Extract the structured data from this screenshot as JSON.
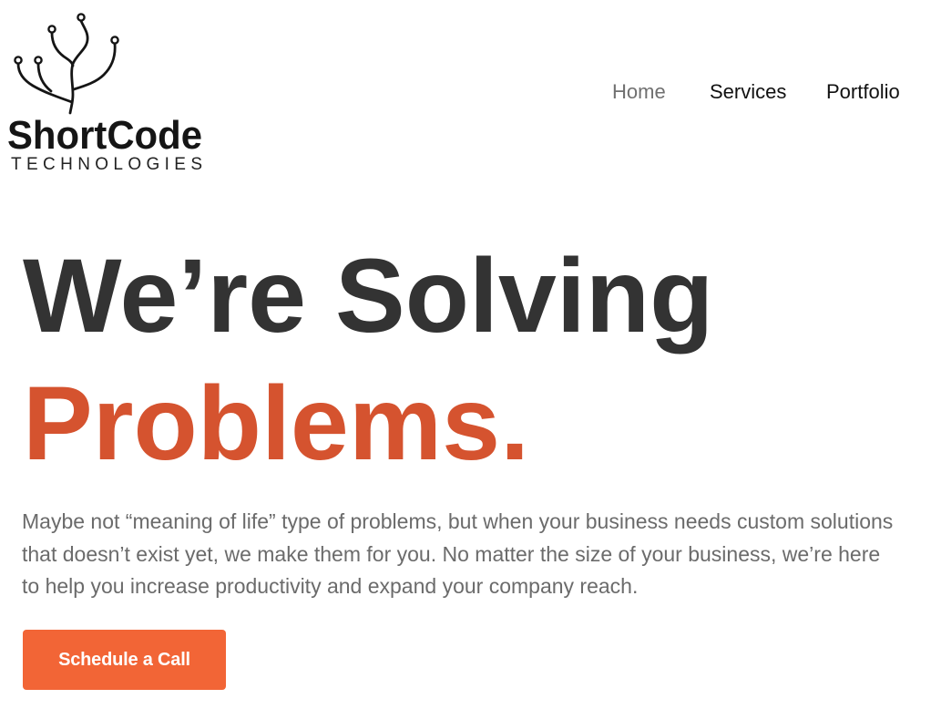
{
  "theme": {
    "heading_color": "#333333",
    "accent_color": "#D5532F",
    "button_color": "#F26536",
    "body_text_color": "#6B6B6B",
    "nav_color": "#111111",
    "nav_active_color": "#707070"
  },
  "logo": {
    "icon": "circuit-tree-icon",
    "wordmark": "ShortCode",
    "tagline": "TECHNOLOGIES"
  },
  "nav": {
    "items": [
      {
        "label": "Home",
        "active": true
      },
      {
        "label": "Services",
        "active": false
      },
      {
        "label": "Portfolio",
        "active": false
      }
    ]
  },
  "hero": {
    "heading_line1": "We’re Solving",
    "heading_line2": "Problems.",
    "description_lines": [
      "Maybe not “meaning of life” type of problems, but when your business needs custom solutions",
      "that doesn’t exist yet, we make them for you. No matter the size of your business, we’re here",
      "to help you increase productivity and expand your company reach."
    ],
    "cta_label": "Schedule a Call"
  }
}
